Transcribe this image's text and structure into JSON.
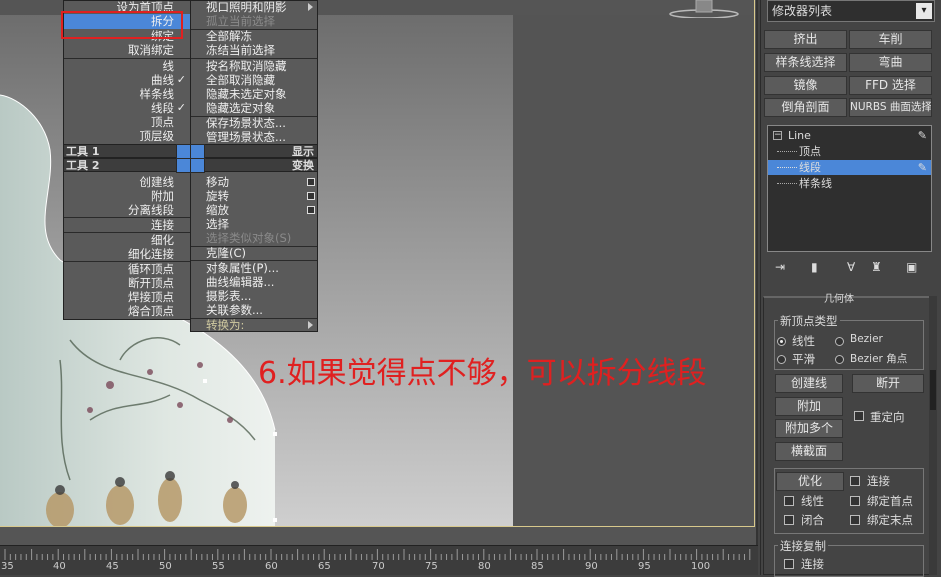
{
  "annotation": "6.如果觉得点不够，可以拆分线段",
  "quad_left": {
    "items_top": [
      "设为首顶点",
      "拆分",
      "绑定",
      "取消绑定"
    ],
    "items_mid": [
      {
        "label": "线",
        "check": false
      },
      {
        "label": "曲线",
        "check": true
      },
      {
        "label": "样条线",
        "check": false
      },
      {
        "label": "线段",
        "check": true
      },
      {
        "label": "顶点",
        "check": false
      },
      {
        "label": "顶层级",
        "check": false
      }
    ],
    "header1": "工具 1",
    "header2": "工具 2",
    "items_bottom": [
      "创建线",
      "附加",
      "分离线段",
      "连接",
      "细化",
      "细化连接",
      "循环顶点",
      "断开顶点",
      "焊接顶点",
      "熔合顶点"
    ]
  },
  "quad_right": {
    "items_top": [
      "视口照明和阴影",
      "孤立当前选择",
      "全部解冻",
      "冻结当前选择",
      "按名称取消隐藏",
      "全部取消隐藏",
      "隐藏未选定对象",
      "隐藏选定对象",
      "保存场景状态...",
      "管理场景状态..."
    ],
    "header1": "显示",
    "header2": "变换",
    "items_bottom": [
      "移动",
      "旋转",
      "缩放",
      "选择",
      "选择类似对象(S)",
      "克隆(C)",
      "对象属性(P)...",
      "曲线编辑器...",
      "摄影表...",
      "关联参数...",
      "转换为:"
    ]
  },
  "timeline": {
    "ticks": [
      "35",
      "40",
      "45",
      "50",
      "55",
      "60",
      "65",
      "70",
      "75",
      "80",
      "85",
      "90",
      "95",
      "100"
    ]
  },
  "panel": {
    "modifier_list": "修改器列表",
    "buttons": [
      "挤出",
      "车削",
      "样条线选择",
      "弯曲",
      "镜像",
      "FFD 选择",
      "倒角剖面",
      "NURBS 曲面选择"
    ],
    "stack": {
      "root": "Line",
      "children": [
        "顶点",
        "线段",
        "样条线"
      ],
      "selected": "线段"
    },
    "rollout_title": "几何体",
    "new_vertex_group": "新顶点类型",
    "radio": [
      "线性",
      "Bezier",
      "平滑",
      "Bezier 角点"
    ],
    "geo_buttons": [
      "创建线",
      "断开",
      "附加",
      "附加多个",
      "横截面"
    ],
    "reorient": "重定向",
    "refine_button": "优化",
    "checkboxes": [
      "连接",
      "线性",
      "绑定首点",
      "闭合",
      "绑定末点"
    ],
    "connect_copy_group": "连接复制",
    "connect_copy_cb": "连接"
  },
  "colors": {
    "highlight": "#4b87d8",
    "annotation": "#e02020"
  }
}
